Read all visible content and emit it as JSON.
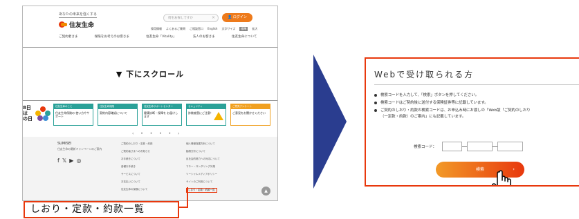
{
  "left_shot": {
    "tagline": "あなたの未来を強くする",
    "logo_text": "住友生命",
    "search_placeholder": "何をお探しですか",
    "login_label": "ログイン",
    "utility_nav": [
      "採用情報",
      "よくあるご質問",
      "ご相談窓口",
      "English",
      "文字サイズ",
      "標準",
      "拡大"
    ],
    "main_nav": [
      "ご契約者さま",
      "保険をお考えのお客さま",
      "住友生命「Vitality」",
      "法人のお客さま",
      "住友生命について"
    ],
    "scroll_hint": "▼  下にスクロール",
    "side_label": "8日は\nの日",
    "cards": [
      {
        "head": "住友生命のこと",
        "body": "住友生命保険の\n使い方やサポート"
      },
      {
        "head": "住友生命保険",
        "body": "契約内容確認について"
      },
      {
        "head": "住友生命サポートセンター",
        "body": "健康診断・保障を\nお届けします"
      },
      {
        "head": "セキュリティ",
        "body": "詐欺被害にご注意！"
      },
      {
        "head": "ご意見アンケート",
        "body": "ご意見をお聞かせください"
      }
    ],
    "footer": {
      "brand": "SUMISEI",
      "brand_sub": "住友生命の最新キャンペーンのご案内",
      "social_icons": [
        "f",
        "𝕏",
        "▶",
        "◎"
      ],
      "links_col2": [
        "ご契約のしおり・定款・約款",
        "ご契約者さまへのお知らせ",
        "お手続きについて",
        "各種お手続き",
        "サービスについて",
        "お支払いについて",
        "住友生命の保険について"
      ],
      "links_col3": [
        "個人情報保護方針について",
        "勧誘方針について",
        "反社会的勢力への対応について",
        "マネー・ロンダリング対策",
        "ソーシャルメディアポリシー",
        "サイトのご利用について"
      ],
      "target_link": "しおり・定款・約款一覧"
    },
    "callout": "しおり・定款・約款一覧"
  },
  "right_panel": {
    "title": "Webで受け取られる方",
    "bullets": [
      "検索コードを入力して、「検索」ボタンを押してください。",
      "検索コードはご契約後に送付する保険証券等に記載しています。",
      "ご契約のしおり・約款の検索コードは、お申込み時にお渡しの「Web版「ご契約のしおり",
      "（一定款・約款）のご案内」にも記載しています。"
    ],
    "code_label": "検索コード：",
    "search_button": "検索",
    "search_arrow": "›"
  },
  "colors": {
    "accent_red": "#e8380d",
    "accent_orange": "#f29a28",
    "arrow_navy": "#2a3d8f"
  },
  "icons": {
    "big_arrow": "right-triangle-arrow",
    "hand": "pointer-hand-icon"
  }
}
